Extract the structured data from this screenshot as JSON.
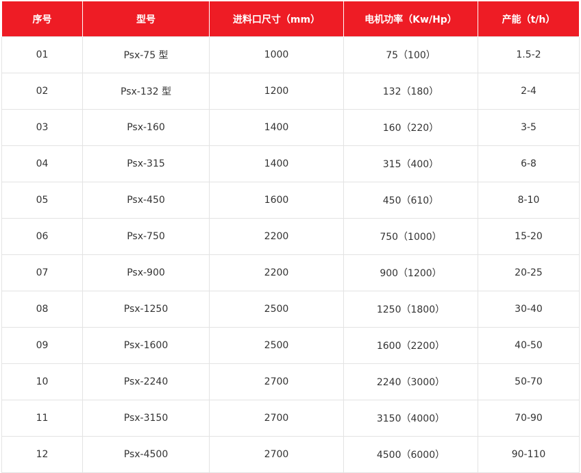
{
  "table": {
    "headers": [
      "序号",
      "型号",
      "进料口尺寸（mm）",
      "电机功率（Kw/Hp）",
      "产能（t/h）"
    ],
    "rows": [
      [
        "01",
        "Psx-75 型",
        "1000",
        "75（100）",
        "1.5-2"
      ],
      [
        "02",
        "Psx-132 型",
        "1200",
        "132（180）",
        "2-4"
      ],
      [
        "03",
        "Psx-160",
        "1400",
        "160（220）",
        "3-5"
      ],
      [
        "04",
        "Psx-315",
        "1400",
        "315（400）",
        "6-8"
      ],
      [
        "05",
        "Psx-450",
        "1600",
        "450（610）",
        "8-10"
      ],
      [
        "06",
        "Psx-750",
        "2200",
        "750（1000）",
        "15-20"
      ],
      [
        "07",
        "Psx-900",
        "2200",
        "900（1200）",
        "20-25"
      ],
      [
        "08",
        "Psx-1250",
        "2500",
        "1250（1800）",
        "30-40"
      ],
      [
        "09",
        "Psx-1600",
        "2500",
        "1600（2200）",
        "40-50"
      ],
      [
        "10",
        "Psx-2240",
        "2700",
        "2240（3000）",
        "50-70"
      ],
      [
        "11",
        "Psx-3150",
        "2700",
        "3150（4000）",
        "70-90"
      ],
      [
        "12",
        "Psx-4500",
        "2700",
        "4500（6000）",
        "90-110"
      ]
    ]
  },
  "colors": {
    "header_background": "#ee1c25",
    "header_text": "#ffffff",
    "cell_text": "#333333",
    "grid_line": "#e3e3e3"
  }
}
